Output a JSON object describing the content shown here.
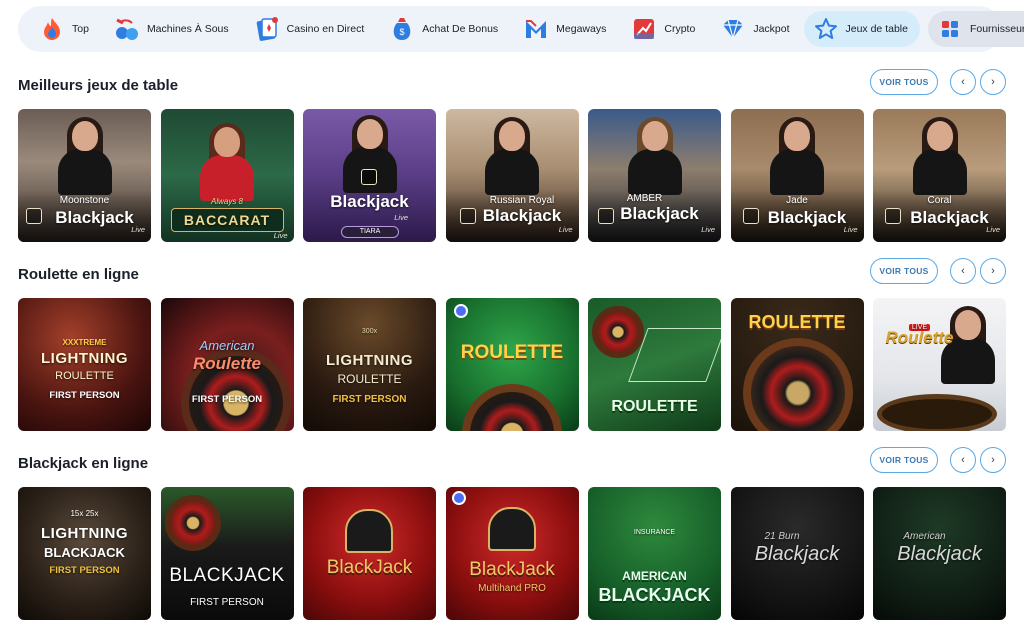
{
  "nav": {
    "items": [
      {
        "label": "Top",
        "icon": "fire-icon"
      },
      {
        "label": "Machines À Sous",
        "icon": "cherries-icon"
      },
      {
        "label": "Casino en Direct",
        "icon": "live-cards-icon"
      },
      {
        "label": "Achat De Bonus",
        "icon": "bonus-bag-icon"
      },
      {
        "label": "Megaways",
        "icon": "megaways-icon"
      },
      {
        "label": "Crypto",
        "icon": "crypto-chart-icon"
      },
      {
        "label": "Jackpot",
        "icon": "diamond-icon"
      },
      {
        "label": "Jeux de table",
        "icon": "star-icon"
      },
      {
        "label": "Fournisseurs",
        "icon": "grid-icon"
      }
    ],
    "active": "Jeux de table"
  },
  "controls": {
    "see_all": "VOIR TOUS",
    "prev": "‹",
    "next": "›"
  },
  "sections": [
    {
      "title": "Meilleurs jeux de table",
      "tiles": [
        {
          "sub": "Moonstone",
          "main": "Blackjack",
          "tag": "Live"
        },
        {
          "sub": "Always 8",
          "main": "BACCARAT",
          "tag": "Live"
        },
        {
          "sub": "",
          "main": "Blackjack",
          "tag": "Live",
          "badge": "TIARA"
        },
        {
          "sub": "Russian Royal",
          "main": "Blackjack",
          "tag": "Live"
        },
        {
          "sub": "AMBER",
          "main": "Blackjack",
          "tag": "Live"
        },
        {
          "sub": "Jade",
          "main": "Blackjack",
          "tag": "Live"
        },
        {
          "sub": "Coral",
          "main": "Blackjack",
          "tag": "Live"
        }
      ]
    },
    {
      "title": "Roulette en ligne",
      "tiles": [
        {
          "top": "XXXTREME",
          "main": "LIGHTNING",
          "sub": "ROULETTE",
          "foot": "FIRST PERSON"
        },
        {
          "top": "American",
          "main": "Roulette",
          "foot": "FIRST PERSON"
        },
        {
          "top": "300x",
          "main": "LIGHTNING",
          "sub": "ROULETTE",
          "foot": "FIRST PERSON"
        },
        {
          "main": "ROULETTE"
        },
        {
          "main": "ROULETTE"
        },
        {
          "main": "ROULETTE"
        },
        {
          "top": "LIVE",
          "main": "Roulette"
        }
      ]
    },
    {
      "title": "Blackjack en ligne",
      "tiles": [
        {
          "top": "15x 25x",
          "main": "LIGHTNING",
          "sub": "BLACKJACK",
          "foot": "FIRST PERSON"
        },
        {
          "main": "BLACKJACK",
          "foot": "FIRST PERSON"
        },
        {
          "main": "BlackJack"
        },
        {
          "main": "BlackJack",
          "sub": "Multihand PRO"
        },
        {
          "top": "AMERICAN",
          "main": "BLACKJACK",
          "sub": "INSURANCE"
        },
        {
          "top": "21 Burn",
          "main": "Blackjack"
        },
        {
          "top": "American",
          "main": "Blackjack"
        }
      ]
    }
  ],
  "colors": {
    "nav_bg": "#eef3f9",
    "nav_active": "#d5ecfb",
    "accent_border": "#5aa9e6",
    "accent_text": "#3b79b0"
  }
}
